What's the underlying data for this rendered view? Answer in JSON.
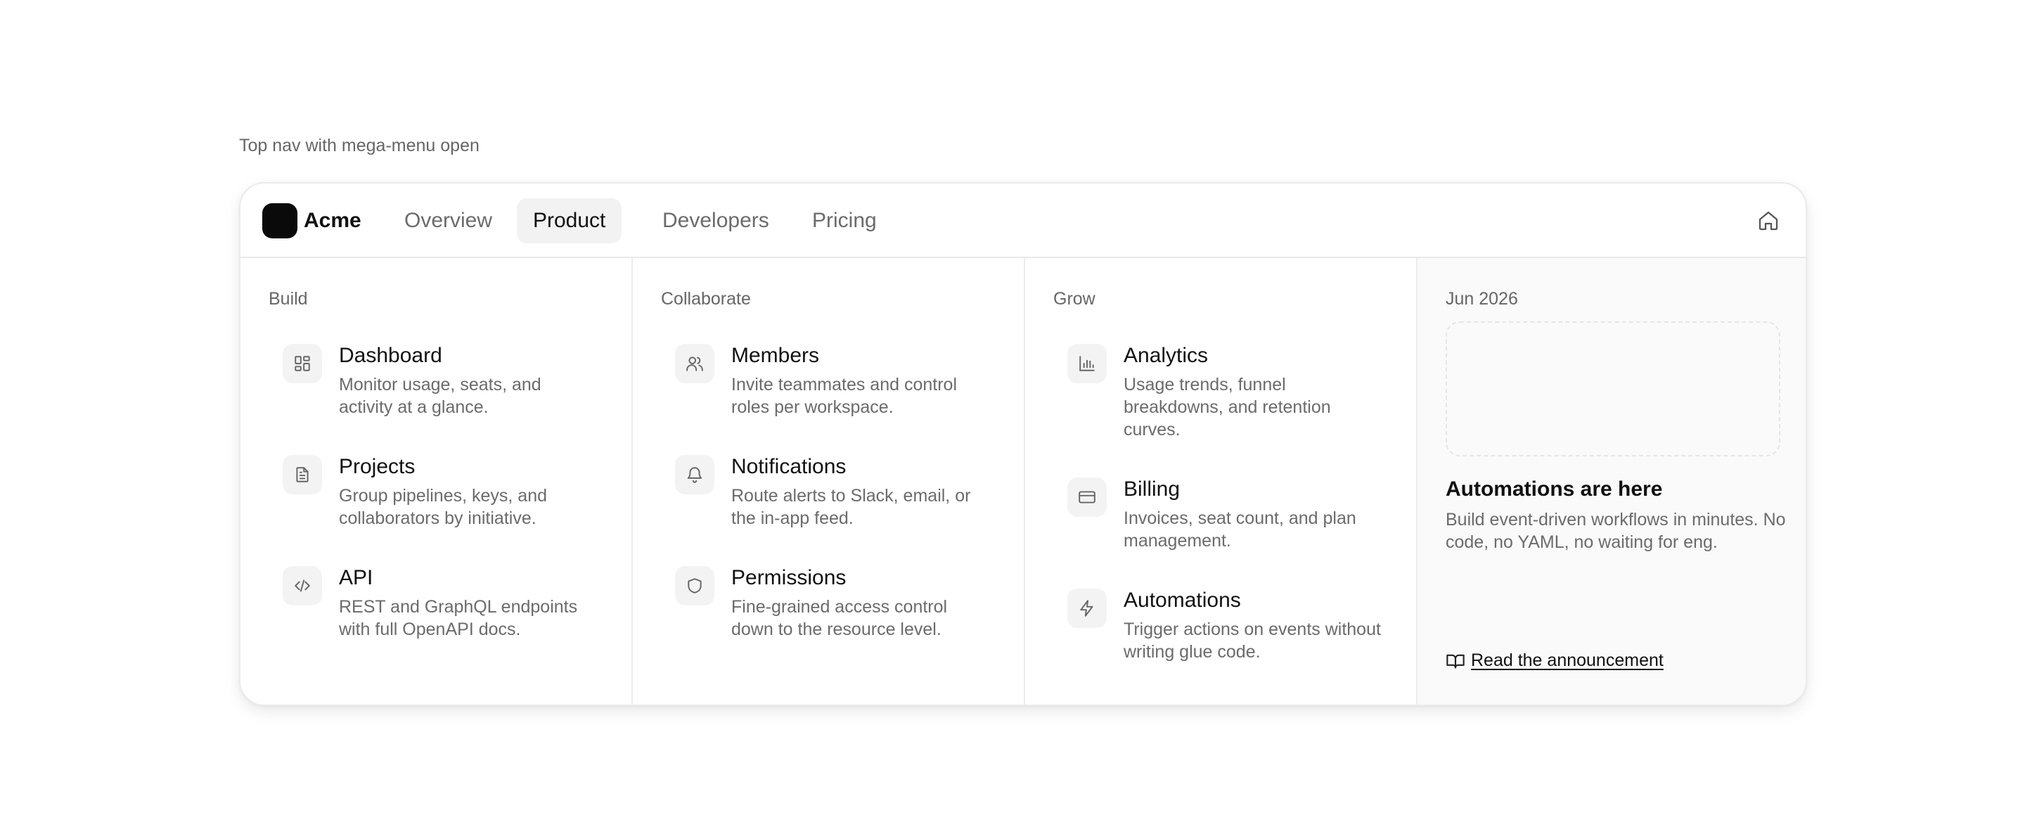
{
  "caption": "Top nav with mega-menu open",
  "nav": {
    "brand": "Acme",
    "items": [
      {
        "label": "Overview"
      },
      {
        "label": "Product",
        "active": true
      },
      {
        "label": "Developers"
      },
      {
        "label": "Pricing"
      }
    ],
    "home_icon": "home-icon"
  },
  "menu": {
    "columns": [
      {
        "title": "Build",
        "items": [
          {
            "title": "Dashboard",
            "description": "Monitor usage, seats, and activity at a glance.",
            "icon": "dashboard-icon"
          },
          {
            "title": "Projects",
            "description": "Group pipelines, keys, and collaborators by initiative.",
            "icon": "file-icon"
          },
          {
            "title": "API",
            "description": "REST and GraphQL endpoints with full OpenAPI docs.",
            "icon": "code-icon"
          }
        ]
      },
      {
        "title": "Collaborate",
        "items": [
          {
            "title": "Members",
            "description": "Invite teammates and control roles per workspace.",
            "icon": "users-icon"
          },
          {
            "title": "Notifications",
            "description": "Route alerts to Slack, email, or the in-app feed.",
            "icon": "bell-icon"
          },
          {
            "title": "Permissions",
            "description": "Fine-grained access control down to the resource level.",
            "icon": "shield-icon"
          }
        ]
      },
      {
        "title": "Grow",
        "items": [
          {
            "title": "Analytics",
            "description": "Usage trends, funnel breakdowns, and retention curves.",
            "icon": "bar-chart-icon"
          },
          {
            "title": "Billing",
            "description": "Invoices, seat count, and plan management.",
            "icon": "credit-card-icon"
          },
          {
            "title": "Automations",
            "description": "Trigger actions on events without writing glue code.",
            "icon": "bolt-icon"
          }
        ]
      }
    ],
    "feature": {
      "date": "Jun 2026",
      "title": "Automations are here",
      "description": "Build event-driven workflows in minutes. No code, no YAML, no waiting for eng.",
      "link_label": "Read the announcement",
      "link_icon": "book-icon"
    }
  },
  "colors": {
    "active_tab_bg": "#f2f2f2",
    "muted_text": "#6b6b6b",
    "feature_bg": "#fafafa"
  }
}
